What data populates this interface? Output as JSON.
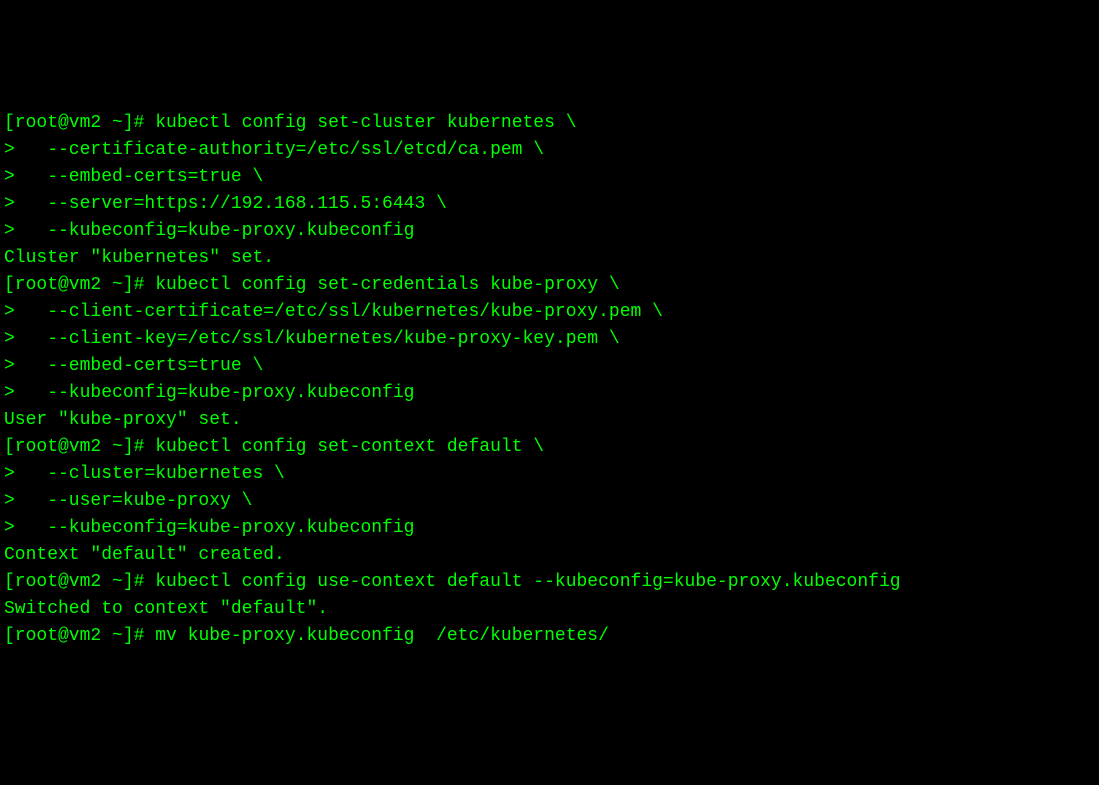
{
  "prompt1": "[root@vm2 ~]# ",
  "cmd1": {
    "l1": "kubectl config set-cluster kubernetes \\",
    "l2": ">   --certificate-authority=/etc/ssl/etcd/ca.pem \\",
    "l3": ">   --embed-certs=true \\",
    "l4": ">   --server=https://192.168.115.5:6443 \\",
    "l5": ">   --kubeconfig=kube-proxy.kubeconfig"
  },
  "out1": "Cluster \"kubernetes\" set.",
  "cmd2": {
    "l1": "kubectl config set-credentials kube-proxy \\",
    "l2": ">   --client-certificate=/etc/ssl/kubernetes/kube-proxy.pem \\",
    "l3": ">   --client-key=/etc/ssl/kubernetes/kube-proxy-key.pem \\",
    "l4": ">   --embed-certs=true \\",
    "l5": ">   --kubeconfig=kube-proxy.kubeconfig"
  },
  "out2": "User \"kube-proxy\" set.",
  "cmd3": {
    "l1": "kubectl config set-context default \\",
    "l2": ">   --cluster=kubernetes \\",
    "l3": ">   --user=kube-proxy \\",
    "l4": ">   --kubeconfig=kube-proxy.kubeconfig"
  },
  "out3": "Context \"default\" created.",
  "cmd4": "kubectl config use-context default --kubeconfig=kube-proxy.kubeconfig",
  "out4": "Switched to context \"default\".",
  "cmd5": "mv kube-proxy.kubeconfig  /etc/kubernetes/"
}
